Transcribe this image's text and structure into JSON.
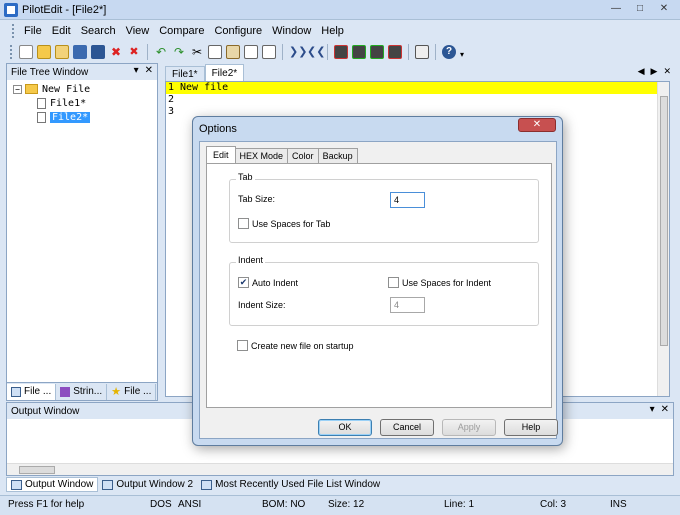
{
  "window": {
    "title": "PilotEdit - [File2*]"
  },
  "menu": [
    "File",
    "Edit",
    "Search",
    "View",
    "Compare",
    "Configure",
    "Window",
    "Help"
  ],
  "toolbar_icons": [
    "new-file-icon",
    "open-file-icon",
    "open-folder-icon",
    "save-icon",
    "save-all-icon",
    "close-icon",
    "close-all-icon",
    "undo-icon",
    "redo-icon",
    "cut-icon",
    "copy-icon",
    "paste-icon",
    "find-icon",
    "replace-icon",
    "indent-icon",
    "outdent-icon",
    "macro-record-icon",
    "macro-play-icon",
    "macro-repeat-icon",
    "macro-stop-icon",
    "hex-icon",
    "help-icon"
  ],
  "file_tree": {
    "title": "File Tree Window",
    "root": "New File",
    "files": [
      {
        "name": "File1*",
        "selected": false
      },
      {
        "name": "File2*",
        "selected": true
      }
    ],
    "tabs": [
      "File ...",
      "Strin...",
      "File ..."
    ]
  },
  "editor": {
    "tabs": [
      {
        "label": "File1*",
        "active": false
      },
      {
        "label": "File2*",
        "active": true
      }
    ],
    "lines": [
      {
        "num": "1",
        "text": "New file"
      },
      {
        "num": "2",
        "text": ""
      },
      {
        "num": "3",
        "text": ""
      }
    ]
  },
  "output": {
    "title": "Output Window",
    "tabs": [
      "Output Window",
      "Output Window 2",
      "Most Recently Used File List Window"
    ]
  },
  "status": {
    "help": "Press F1 for help",
    "line_ending": "DOS",
    "encoding": "ANSI",
    "bom": "BOM: NO",
    "size": "Size: 12",
    "line": "Line: 1",
    "col": "Col: 3",
    "mode": "INS"
  },
  "dialog": {
    "title": "Options",
    "tabs": [
      "Edit",
      "HEX Mode",
      "Color",
      "Backup"
    ],
    "tab_group": {
      "label": "Tab",
      "tab_size_label": "Tab Size:",
      "tab_size_value": "4",
      "use_spaces_label": "Use Spaces for Tab",
      "use_spaces_checked": false
    },
    "indent_group": {
      "label": "Indent",
      "auto_indent_label": "Auto Indent",
      "auto_indent_checked": true,
      "use_spaces_label": "Use Spaces for Indent",
      "use_spaces_checked": false,
      "indent_size_label": "Indent Size:",
      "indent_size_value": "4"
    },
    "create_new_label": "Create new file on startup",
    "create_new_checked": false,
    "buttons": {
      "ok": "OK",
      "cancel": "Cancel",
      "apply": "Apply",
      "help": "Help"
    }
  },
  "colors": {
    "current_line": "#ffff00",
    "selection": "#3399ff",
    "chrome": "#dbe6f4",
    "close_button": "#c75050"
  }
}
